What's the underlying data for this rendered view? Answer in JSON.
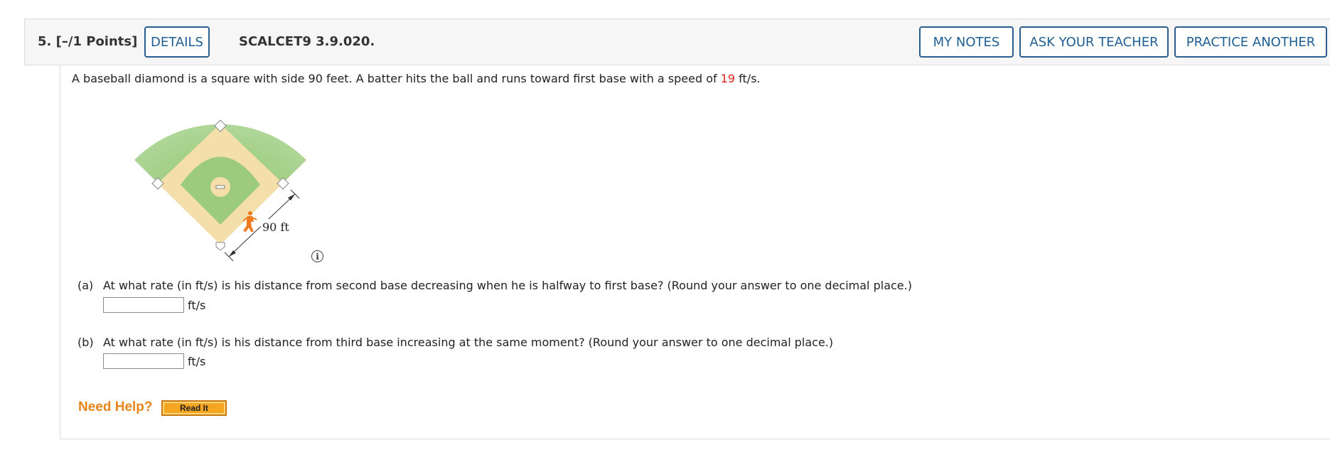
{
  "header": {
    "question_number": "5.",
    "points": "[–/1 Points]",
    "details_label": "DETAILS",
    "problem_code": "SCALCET9 3.9.020.",
    "my_notes_label": "MY NOTES",
    "ask_teacher_label": "ASK YOUR TEACHER",
    "practice_another_label": "PRACTICE ANOTHER"
  },
  "problem": {
    "text_before": "A baseball diamond is a square with side 90 feet. A batter hits the ball and runs toward first base with a speed of ",
    "speed": "19",
    "text_after": " ft/s."
  },
  "diagram": {
    "side_label": "90 ft",
    "colors": {
      "grass": "#9dcb7e",
      "infield_dirt": "#f4dfaa",
      "base": "#ffffff",
      "runner": "#f07a1e"
    }
  },
  "parts": [
    {
      "label": "(a)",
      "question": "At what rate (in ft/s) is his distance from second base decreasing when he is halfway to first base? (Round your answer to one decimal place.)",
      "value": "",
      "unit": "ft/s"
    },
    {
      "label": "(b)",
      "question": "At what rate (in ft/s) is his distance from third base increasing at the same moment? (Round your answer to one decimal place.)",
      "value": "",
      "unit": "ft/s"
    }
  ],
  "help": {
    "need_help_label": "Need Help?",
    "read_it_label": "Read It"
  },
  "colors": {
    "button_border": "#2a5d8f",
    "button_text": "#1f5e93",
    "highlight_red": "#e0201b",
    "help_orange": "#e8861c",
    "read_it_bg": "#f4a623"
  }
}
